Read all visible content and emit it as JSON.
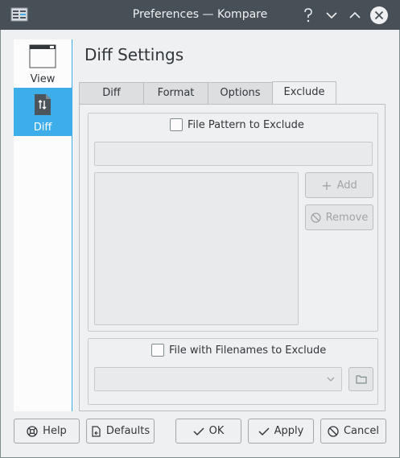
{
  "window": {
    "title": "Preferences — Kompare"
  },
  "sidebar": {
    "items": [
      {
        "label": "View",
        "icon": "window-icon"
      },
      {
        "label": "Diff",
        "icon": "diff-icon"
      }
    ]
  },
  "page": {
    "heading": "Diff Settings"
  },
  "tabs": [
    {
      "label": "Diff"
    },
    {
      "label": "Format"
    },
    {
      "label": "Options"
    },
    {
      "label": "Exclude"
    }
  ],
  "exclude": {
    "pattern_checkbox_label": "File Pattern to Exclude",
    "pattern_input_value": "",
    "add_label": "Add",
    "remove_label": "Remove",
    "file_checkbox_label": "File with Filenames to Exclude",
    "file_combo_value": ""
  },
  "footer": {
    "help": "Help",
    "defaults": "Defaults",
    "ok": "OK",
    "apply": "Apply",
    "cancel": "Cancel"
  },
  "colors": {
    "titlebar": "#475057",
    "accent": "#3daee9",
    "window_bg": "#eff0f1"
  }
}
